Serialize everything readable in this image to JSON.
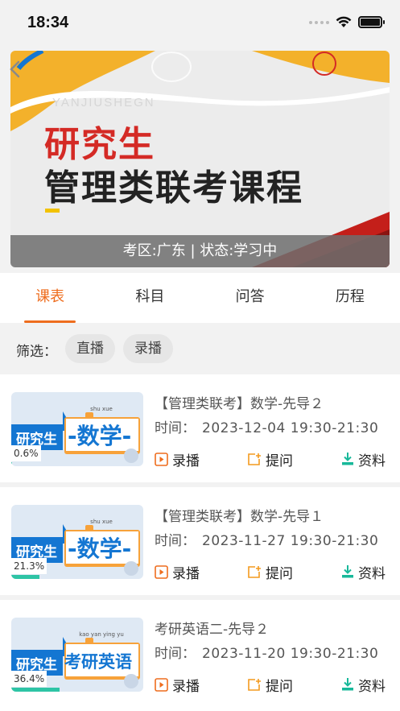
{
  "status": {
    "time": "18:34"
  },
  "banner": {
    "watermark": "YANJIUSHEGN",
    "title_line1": "研究生",
    "title_line2": "管理类联考课程",
    "info": "考区:广东 | 状态:学习中"
  },
  "tabs": [
    {
      "label": "课表",
      "active": true
    },
    {
      "label": "科目",
      "active": false
    },
    {
      "label": "问答",
      "active": false
    },
    {
      "label": "历程",
      "active": false
    }
  ],
  "filter": {
    "label": "筛选：",
    "chips": [
      "直播",
      "录播"
    ]
  },
  "courses": [
    {
      "thumb_left": "研究生",
      "thumb_right": "-数学-",
      "thumb_pinyin": "shu xue",
      "progress_label": "0.6%",
      "progress": 0.006,
      "title": "【管理类联考】数学-先导２",
      "time_label": "时间：",
      "time_value": "2023-12-04  19:30-21:30",
      "actions": [
        "录播",
        "提问",
        "资料"
      ]
    },
    {
      "thumb_left": "研究生",
      "thumb_right": "-数学-",
      "thumb_pinyin": "shu xue",
      "progress_label": "21.3%",
      "progress": 0.213,
      "title": "【管理类联考】数学-先导１",
      "time_label": "时间：",
      "time_value": "2023-11-27  19:30-21:30",
      "actions": [
        "录播",
        "提问",
        "资料"
      ]
    },
    {
      "thumb_left": "研究生",
      "thumb_right": "考研英语",
      "thumb_pinyin": "kao yan ying yu",
      "progress_label": "36.4%",
      "progress": 0.364,
      "title": "考研英语二-先导２",
      "time_label": "时间：",
      "time_value": "2023-11-20  19:30-21:30",
      "actions": [
        "录播",
        "提问",
        "资料"
      ]
    }
  ],
  "colors": {
    "accent": "#ee6d1e",
    "brand_blue": "#1476d2",
    "progress": "#2ec4a5",
    "icon_orange": "#f39a1e",
    "icon_teal": "#18b89a"
  }
}
